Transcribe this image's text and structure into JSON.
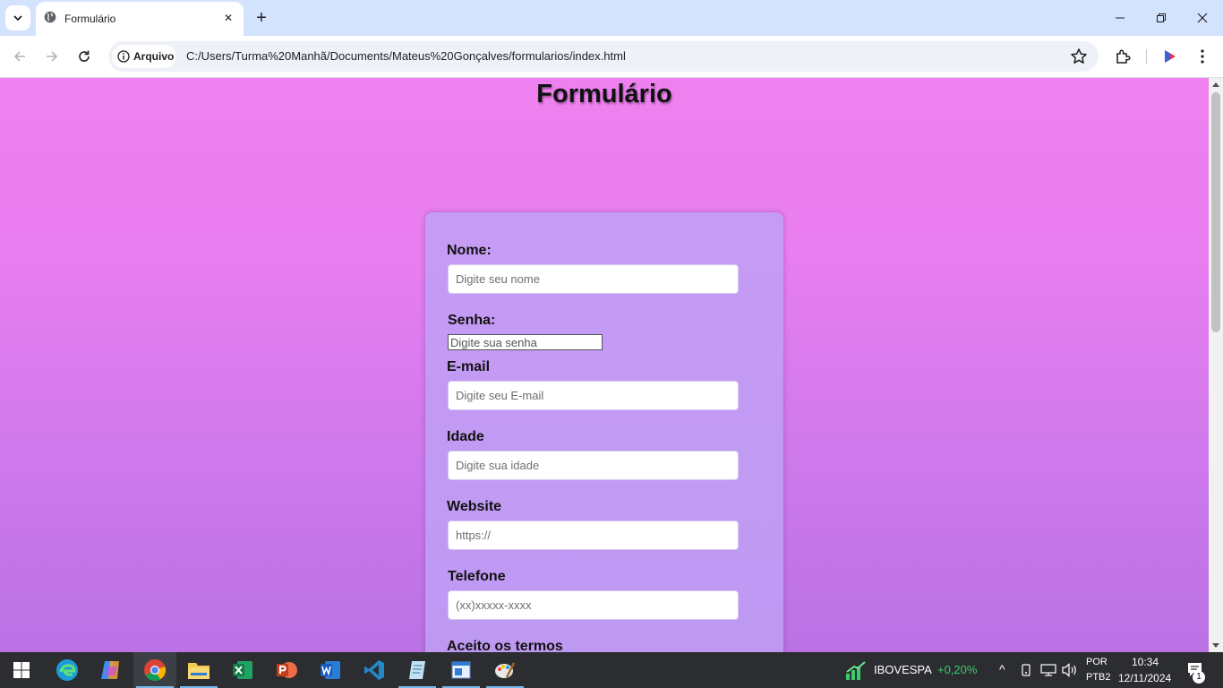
{
  "browser": {
    "tab_title": "Formulário",
    "chip_label": "Arquivo",
    "url": "C:/Users/Turma%20Manhã/Documents/Mateus%20Gonçalves/formularios/index.html"
  },
  "page": {
    "title": "Formulário",
    "fields": {
      "nome": {
        "label": "Nome:",
        "placeholder": "Digite seu nome"
      },
      "senha": {
        "label": "Senha:",
        "placeholder": "Digite sua senha"
      },
      "email": {
        "label": "E-mail",
        "placeholder": "Digite seu E-mail"
      },
      "idade": {
        "label": "Idade",
        "placeholder": "Digite sua idade"
      },
      "website": {
        "label": "Website",
        "placeholder": "https://"
      },
      "telefone": {
        "label": "Telefone",
        "placeholder": "(xx)xxxxx-xxxx"
      },
      "termos": {
        "label": "Aceito os termos"
      }
    }
  },
  "taskbar": {
    "apps": [
      "start-icon",
      "edge-icon",
      "copilot-icon",
      "chrome-icon",
      "file-explorer-icon",
      "excel-icon",
      "powerpoint-icon",
      "word-icon",
      "vscode-icon",
      "notepad-icon",
      "app-icon",
      "paint-icon"
    ],
    "stock_name": "IBOVESPA",
    "stock_change": "+0,20%",
    "lang_top": "POR",
    "lang_bottom": "PTB2",
    "time": "10:34",
    "date": "12/11/2024",
    "notification_count": "1"
  },
  "colors": {
    "stock_change": "#3ccb6b",
    "page_gradient_top": "#ef80ef",
    "page_gradient_bottom": "#ba72e4"
  }
}
